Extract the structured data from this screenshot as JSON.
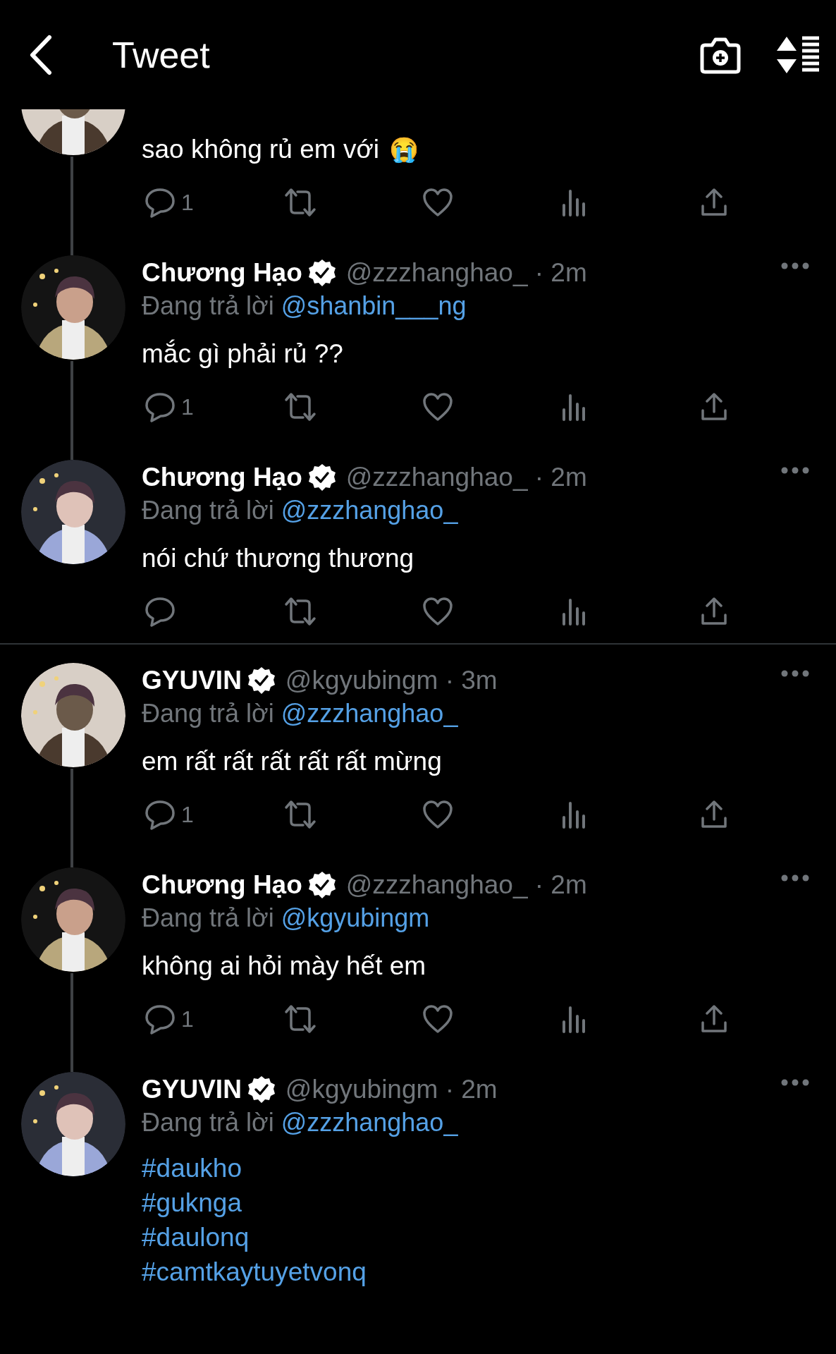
{
  "header": {
    "title": "Tweet"
  },
  "threads": [
    {
      "tweets": [
        {
          "text": "sao không rủ em với",
          "emoji": "😭",
          "replies": "1",
          "actions": true
        },
        {
          "name": "Chương Hạo",
          "verified": true,
          "meta": "@zzzhanghao_ · 2m",
          "reply_label": "Đang trả lời",
          "reply_handle": "@shanbin___ng",
          "text": "mắc gì phải rủ ??",
          "replies": "1",
          "actions": true
        },
        {
          "name": "Chương Hạo",
          "verified": true,
          "meta": "@zzzhanghao_ · 2m",
          "reply_label": "Đang trả lời",
          "reply_handle": "@zzzhanghao_",
          "text": "nói chứ thương thương",
          "actions": true
        }
      ]
    },
    {
      "tweets": [
        {
          "name": "GYUVIN",
          "verified": true,
          "meta": "@kgyubingm · 3m",
          "reply_label": "Đang trả lời",
          "reply_handle": "@zzzhanghao_",
          "text": "em rất rất rất rất rất mừng",
          "replies": "1",
          "actions": true
        },
        {
          "name": "Chương Hạo",
          "verified": true,
          "meta": "@zzzhanghao_ · 2m",
          "reply_label": "Đang trả lời",
          "reply_handle": "@kgyubingm",
          "text": "không ai hỏi mày hết em",
          "replies": "1",
          "actions": true
        },
        {
          "name": "GYUVIN",
          "verified": true,
          "meta": "@kgyubingm · 2m",
          "reply_label": "Đang trả lời",
          "reply_handle": "@zzzhanghao_",
          "hashtags": [
            "#daukho",
            "#guknga",
            "#daulonq",
            "#camtkaytuyetvonq"
          ],
          "actions": false
        }
      ]
    }
  ]
}
